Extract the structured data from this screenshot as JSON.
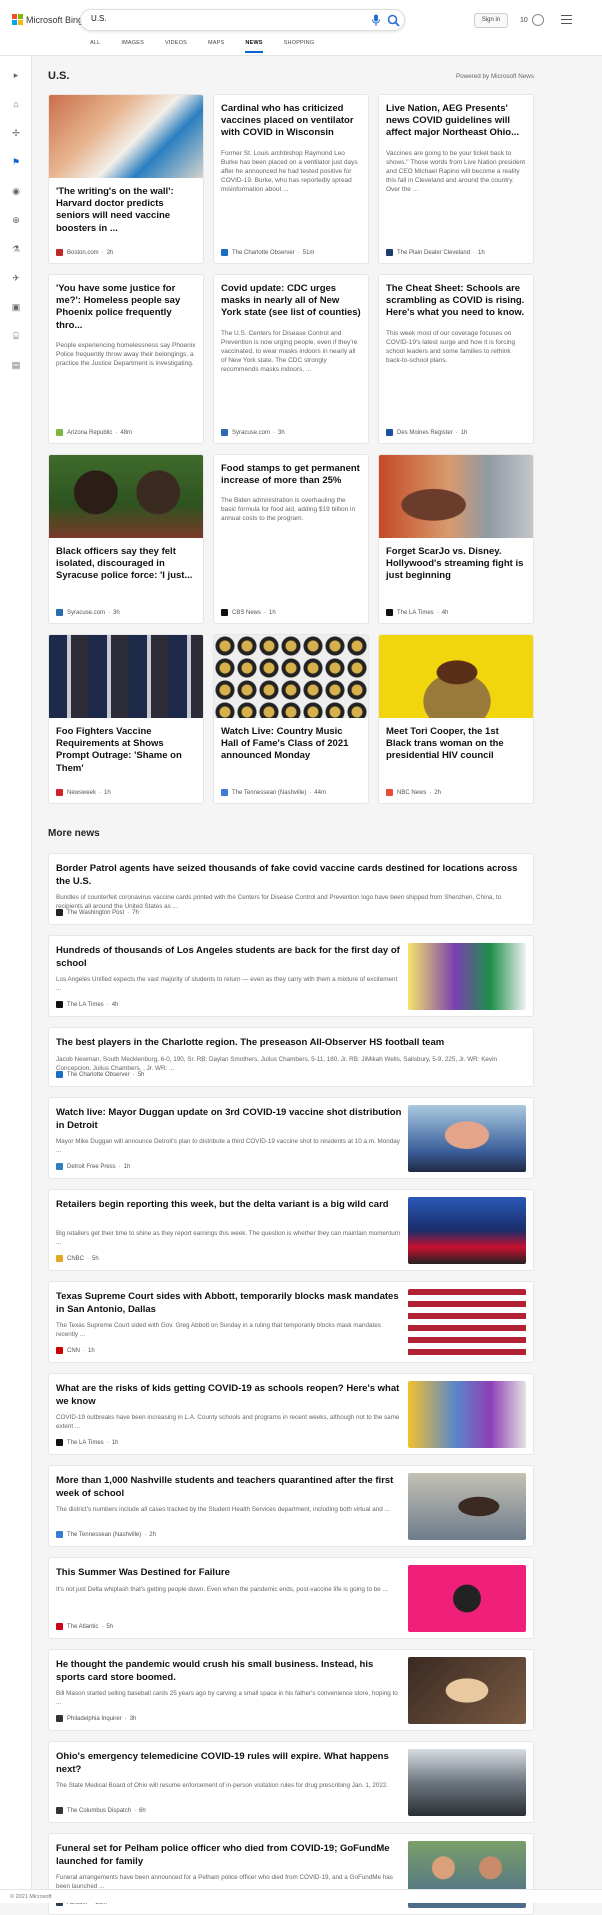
{
  "header": {
    "brand": "Microsoft Bing",
    "search_value": "U.S.",
    "sign_in": "Sign in",
    "rewards_count": "10",
    "tabs": [
      {
        "label": "ALL"
      },
      {
        "label": "IMAGES"
      },
      {
        "label": "VIDEOS"
      },
      {
        "label": "MAPS"
      },
      {
        "label": "NEWS",
        "active": true
      },
      {
        "label": "SHOPPING"
      }
    ]
  },
  "sidebar": {
    "icons": [
      "expand-icon",
      "home-icon",
      "sports-icon",
      "politics-flag-icon",
      "location-icon",
      "world-icon",
      "science-icon",
      "technology-icon",
      "entertainment-icon",
      "business-icon",
      "money-icon"
    ]
  },
  "main": {
    "topic": "U.S.",
    "powered_by": "Powered by Microsoft News",
    "cards": [
      {
        "title": "'The writing's on the wall': Harvard doctor predicts seniors will need vaccine boosters in ...",
        "snippet": "",
        "source": "Boston.com",
        "time": "2h",
        "fav": "#c0282d",
        "img": "vaccine"
      },
      {
        "title": "Cardinal who has criticized vaccines placed on ventilator with COVID in Wisconsin",
        "snippet": "Former St. Louis archbishop Raymond Leo Burke has been placed on a ventilator just days after he announced he had tested positive for COVID-19. Burke, who has reportedly spread misinformation about ...",
        "source": "The Charlotte Observer",
        "time": "51m",
        "fav": "#1a6ec6",
        "img": ""
      },
      {
        "title": "Live Nation, AEG Presents' news COVID guidelines will affect major Northeast Ohio...",
        "snippet": "Vaccines are going to be your ticket back to shows.\" Those words from Live Nation president and CEO Michael Rapino will become a reality this fall in Cleveland and around the country. Over the ...",
        "source": "The Plain Dealer Cleveland",
        "time": "1h",
        "fav": "#1c3b6e",
        "img": ""
      },
      {
        "title": "'You have some justice for me?': Homeless people say Phoenix police frequently thro...",
        "snippet": "People experiencing homelessness say Phoenix Police frequently throw away their belongings, a practice the Justice Department is investigating.",
        "source": "Arizona Republic",
        "time": "48m",
        "fav": "#7db442",
        "img": ""
      },
      {
        "title": "Covid update: CDC urges masks in nearly all of New York state (see list of counties)",
        "snippet": "The U.S. Centers for Disease Control and Prevention is now urging people, even if they're vaccinated, to wear masks indoors in nearly all of New York state. The CDC strongly recommends masks indoors, ...",
        "source": "Syracuse.com",
        "time": "3h",
        "fav": "#2b6cb0",
        "img": ""
      },
      {
        "title": "The Cheat Sheet: Schools are scrambling as COVID is rising. Here's what you need to know.",
        "snippet": "This week most of our coverage focuses on COVID-19's latest surge and how it is forcing school leaders and some families to rethink back-to-school plans.",
        "source": "Des Moines Register",
        "time": "1h",
        "fav": "#1c4fa0",
        "img": ""
      },
      {
        "title": "Black officers say they felt isolated, discouraged in Syracuse police force: 'I just...",
        "snippet": "",
        "source": "Syracuse.com",
        "time": "3h",
        "fav": "#2b6cb0",
        "img": "officers"
      },
      {
        "title": "Food stamps to get permanent increase of more than 25%",
        "snippet": "The Biden administration is overhauling the basic formula for food aid, adding $19 billion in annual costs to the program.",
        "source": "CBS News",
        "time": "1h",
        "fav": "#111111",
        "img": ""
      },
      {
        "title": "Forget ScarJo vs. Disney. Hollywood's streaming fight is just beginning",
        "snippet": "",
        "source": "The LA Times",
        "time": "4h",
        "fav": "#111111",
        "img": "scarjo"
      },
      {
        "title": "Foo Fighters Vaccine Requirements at Shows Prompt Outrage: 'Shame on Them'",
        "snippet": "",
        "source": "Newsweek",
        "time": "1h",
        "fav": "#d12027",
        "img": "band"
      },
      {
        "title": "Watch Live: Country Music Hall of Fame's Class of 2021 announced Monday",
        "snippet": "",
        "source": "The Tennessean (Nashville)",
        "time": "44m",
        "fav": "#3a7bd5",
        "img": "records"
      },
      {
        "title": "Meet Tori Cooper, the 1st Black trans woman on the presidential HIV council",
        "snippet": "",
        "source": "NBC News",
        "time": "2h",
        "fav": "#e84b37",
        "img": "tori"
      }
    ],
    "more_news_heading": "More news",
    "more_news": [
      {
        "title": "Border Patrol agents have seized thousands of fake covid vaccine cards destined for locations across the U.S.",
        "snippet": "Bundles of counterfeit coronavirus vaccine cards printed with the Centers for Disease Control and Prevention logo have been shipped from Shenzhen, China, to recipients all around the United States as ...",
        "source": "The Washington Post",
        "time": "7h",
        "fav": "#222222",
        "thumb": ""
      },
      {
        "title": "Hundreds of thousands of Los Angeles students are back for the first day of school",
        "snippet": "Los Angeles Unified expects the vast majority of students to return — even as they carry with them a mixture of excitement ...",
        "source": "The LA Times",
        "time": "4h",
        "fav": "#111111",
        "thumb": "students"
      },
      {
        "title": "The best players in the Charlotte region. The preseason All-Observer HS football team",
        "snippet": "Jacob Newman, South Mecklenburg, 6-0, 190, Sr. RB: Daylan Smothers, Julius Chambers, 5-11, 180, Jr. RB: JiMikah Wells, Salisbury, 5-9, 225, Jr. WR: Kevin Concepcion, Julius Chambers, , Jr. WR: ...",
        "source": "The Charlotte Observer",
        "time": "5h",
        "fav": "#1a6ec6",
        "thumb": ""
      },
      {
        "title": "Watch live: Mayor Duggan update on 3rd COVID-19 vaccine shot distribution in Detroit",
        "snippet": "Mayor Mike Duggan will announce Detroit's plan to distribute a third COVID-19 vaccine shot to residents at 10 a.m. Monday ...",
        "source": "Detroit Free Press",
        "time": "1h",
        "fav": "#2f80c2",
        "thumb": "mayor"
      },
      {
        "title": "Retailers begin reporting this week, but the delta variant is a big wild card",
        "snippet": "Big retailers get their time to shine as they report earnings this week. The question is whether they can maintain momentum ...",
        "source": "CNBC",
        "time": "5h",
        "fav": "#e5a823",
        "thumb": "traders"
      },
      {
        "title": "Texas Supreme Court sides with Abbott, temporarily blocks mask mandates in San Antonio, Dallas",
        "snippet": "The Texas Supreme Court sided with Gov. Greg Abbott on Sunday in a ruling that temporarily blocks mask mandates recently ...",
        "source": "CNN",
        "time": "1h",
        "fav": "#cc0000",
        "thumb": "abbott"
      },
      {
        "title": "What are the risks of kids getting COVID-19 as schools reopen? Here's what we know",
        "snippet": "COVID-19 outbreaks have been increasing in L.A. County schools and programs in recent weeks, although not to the same extent ...",
        "source": "The LA Times",
        "time": "1h",
        "fav": "#111111",
        "thumb": "classroom"
      },
      {
        "title": "More than 1,000 Nashville students and teachers quarantined after the first week of school",
        "snippet": "The district's numbers include all cases tracked by the Student Health Services department, including both virtual and ...",
        "source": "The Tennessean (Nashville)",
        "time": "2h",
        "fav": "#3a7bd5",
        "thumb": "teacher"
      },
      {
        "title": "This Summer Was Destined for Failure",
        "snippet": "It's not just Delta whiplash that's getting people down. Even when the pandemic ends, post-vaccine life is going to be ...",
        "source": "The Atlantic",
        "time": "5h",
        "fav": "#d0021b",
        "thumb": "pink"
      },
      {
        "title": "He thought the pandemic would crush his small business. Instead, his sports card store boomed.",
        "snippet": "Bill Mason started selling baseball cards 25 years ago by carving a small space in his father's convenience store, hoping to ...",
        "source": "Philadelphia Inquirer",
        "time": "3h",
        "fav": "#333333",
        "thumb": "cards"
      },
      {
        "title": "Ohio's emergency telemedicine COVID-19 rules will expire. What happens next?",
        "snippet": "The State Medical Board of Ohio will resume enforcement of in-person visitation rules for drug prescribing Jan. 1, 2022.",
        "source": "The Columbus Dispatch",
        "time": "6h",
        "fav": "#333333",
        "thumb": "car"
      },
      {
        "title": "Funeral set for Pelham police officer who died from COVID-19; GoFundMe launched for family",
        "snippet": "Funeral arrangements have been announced for a Pelham police officer who died from COVID-19, and a GoFundMe has been launched ...",
        "source": "AL.com",
        "time": "36m",
        "fav": "#2c3e50",
        "thumb": "family"
      }
    ]
  },
  "footer": {
    "text": "© 2021 Microsoft"
  }
}
